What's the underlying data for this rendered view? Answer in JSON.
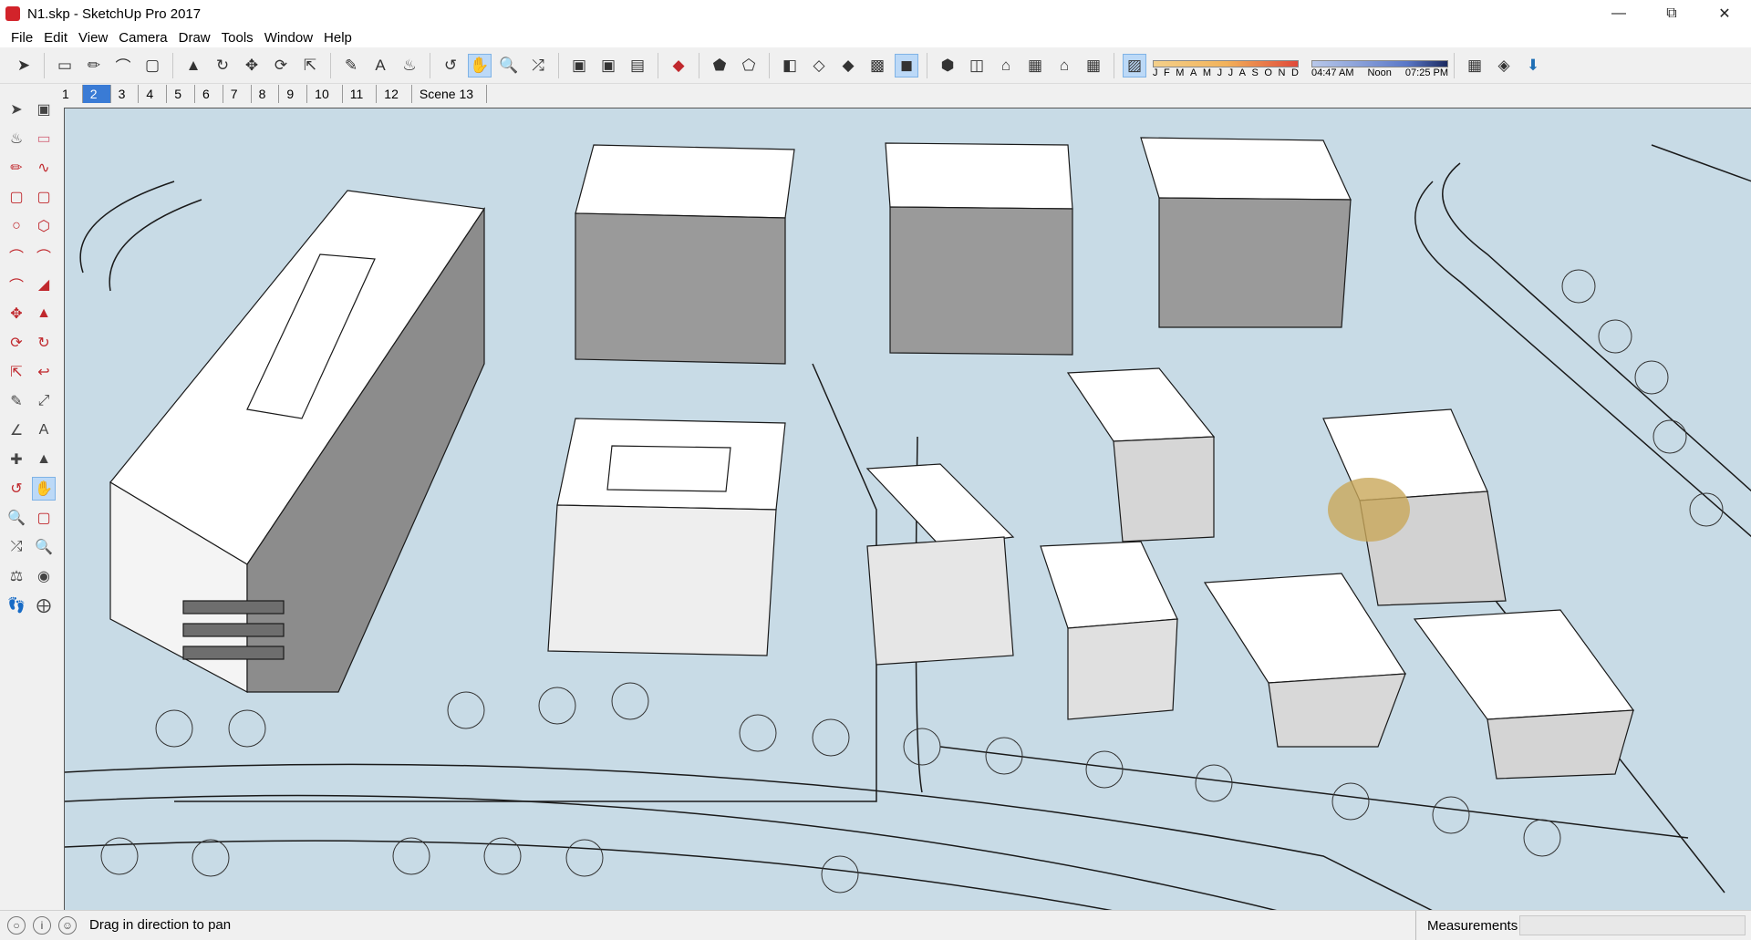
{
  "window": {
    "title": "N1.skp - SketchUp Pro 2017",
    "controls": [
      "minimize",
      "restore",
      "close"
    ]
  },
  "menu": [
    "File",
    "Edit",
    "View",
    "Camera",
    "Draw",
    "Tools",
    "Window",
    "Help"
  ],
  "toolbar": {
    "icons": [
      "select-icon",
      "eraser-icon",
      "pencil-icon",
      "arc-icon",
      "rectangle-icon",
      "push-pull-icon",
      "follow-me-icon",
      "move-icon",
      "rotate-icon",
      "scale-icon",
      "tape-measure-icon",
      "text-icon",
      "paint-bucket-icon",
      "orbit-icon",
      "pan-icon",
      "zoom-icon",
      "zoom-extents-icon",
      "warehouse-icon",
      "extension-warehouse-icon",
      "layout-icon",
      "ruby-icon",
      "xray-icon",
      "back-edges-icon",
      "wireframe-icon",
      "hidden-line-icon",
      "shaded-icon",
      "shaded-textures-icon",
      "monochrome-icon",
      "iso-view-icon",
      "top-view-icon",
      "front-view-icon",
      "right-view-icon",
      "back-view-icon",
      "left-view-icon",
      "shadows-icon"
    ],
    "active_icon": "pan-icon",
    "months": [
      "J",
      "F",
      "M",
      "A",
      "M",
      "J",
      "J",
      "A",
      "S",
      "O",
      "N",
      "D"
    ],
    "time_labels": [
      "04:47 AM",
      "Noon",
      "07:25 PM"
    ]
  },
  "scenes": {
    "tabs": [
      "1",
      "2",
      "3",
      "4",
      "5",
      "6",
      "7",
      "8",
      "9",
      "10",
      "11",
      "12",
      "Scene 13"
    ],
    "active": "2"
  },
  "left_tools": [
    [
      "select-icon",
      "make-component-icon"
    ],
    [
      "paint-bucket-icon",
      "eraser-icon"
    ],
    [
      "pencil-icon",
      "freehand-icon"
    ],
    [
      "rectangle-icon",
      "rotated-rectangle-icon"
    ],
    [
      "circle-icon",
      "polygon-icon"
    ],
    [
      "arc-icon",
      "two-point-arc-icon"
    ],
    [
      "three-point-arc-icon",
      "pie-icon"
    ],
    [
      "move-icon",
      "push-pull-icon"
    ],
    [
      "rotate-icon",
      "follow-me-icon"
    ],
    [
      "scale-icon",
      "offset-icon"
    ],
    [
      "tape-measure-icon",
      "dimension-icon"
    ],
    [
      "protractor-icon",
      "text-icon"
    ],
    [
      "axes-icon",
      "3d-text-icon"
    ],
    [
      "orbit-icon",
      "pan-icon"
    ],
    [
      "zoom-icon",
      "zoom-window-icon"
    ],
    [
      "zoom-extents-icon",
      "previous-view-icon"
    ],
    [
      "position-camera-icon",
      "look-around-icon"
    ],
    [
      "walk-icon",
      "section-plane-icon"
    ]
  ],
  "status": {
    "message": "Drag in direction to pan",
    "measurements_label": "Measurements",
    "measurements_value": ""
  },
  "colors": {
    "viewport_bg": "#c8dbe6",
    "active_tab": "#3a7bd5",
    "building_face": "#ffffff",
    "line": "#1a1a1a"
  }
}
